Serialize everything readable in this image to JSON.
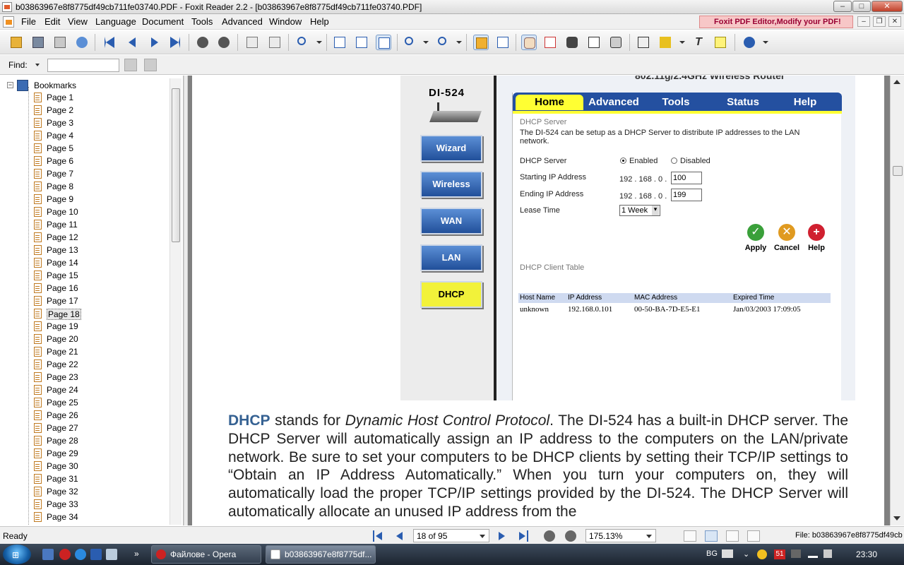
{
  "window": {
    "title": "b03863967e8f8775df49cb711fe03740.PDF - Foxit Reader 2.2 - [b03863967e8f8775df49cb711fe03740.PDF]",
    "minimize": "–",
    "maximize": "□",
    "close": "✕"
  },
  "menu": {
    "items": [
      "File",
      "Edit",
      "View",
      "Language",
      "Document",
      "Tools",
      "Advanced",
      "Window",
      "Help"
    ],
    "ad_text": "Foxit PDF Editor,Modify your PDF!"
  },
  "find": {
    "label": "Find:",
    "value": ""
  },
  "bookmarks": {
    "root_label": "Bookmarks",
    "selected_index": 17,
    "pages": [
      "Page 1",
      "Page 2",
      "Page 3",
      "Page 4",
      "Page 5",
      "Page 6",
      "Page 7",
      "Page 8",
      "Page 9",
      "Page 10",
      "Page 11",
      "Page 12",
      "Page 13",
      "Page 14",
      "Page 15",
      "Page 16",
      "Page 17",
      "Page 18",
      "Page 19",
      "Page 20",
      "Page 21",
      "Page 22",
      "Page 23",
      "Page 24",
      "Page 25",
      "Page 26",
      "Page 27",
      "Page 28",
      "Page 29",
      "Page 30",
      "Page 31",
      "Page 32",
      "Page 33",
      "Page 34"
    ]
  },
  "document": {
    "router": {
      "header_text": "802.11g/2.4GHz Wireless Router",
      "model": "DI-524",
      "nav": [
        "Wizard",
        "Wireless",
        "WAN",
        "LAN",
        "DHCP"
      ],
      "active_nav": "DHCP",
      "tabs": [
        "Home",
        "Advanced",
        "Tools",
        "Status",
        "Help"
      ],
      "active_tab": "Home",
      "section_title": "DHCP Server",
      "description": "The DI-524 can be setup as a DHCP Server to distribute IP addresses to the LAN network.",
      "dhcp_server_label": "DHCP Server",
      "enabled_label": "Enabled",
      "disabled_label": "Disabled",
      "starting_ip_label": "Starting IP Address",
      "ending_ip_label": "Ending IP Address",
      "ip_prefix": "192 . 168 . 0 .",
      "starting_ip_value": "100",
      "ending_ip_value": "199",
      "lease_time_label": "Lease Time",
      "lease_time_value": "1 Week",
      "apply": "Apply",
      "cancel": "Cancel",
      "help": "Help",
      "client_table_title": "DHCP Client Table",
      "client_table_headers": [
        "Host Name",
        "IP Address",
        "MAC Address",
        "Expired Time"
      ],
      "client_table_rows": [
        [
          "unknown",
          "192.168.0.101",
          "00-50-BA-7D-E5-E1",
          "Jan/03/2003 17:09:05"
        ]
      ]
    },
    "body_lead": "DHCP",
    "body_part1": " stands for ",
    "body_italic": "Dynamic Host Control Protocol",
    "body_part2": ". The DI-524 has a built-in DHCP server. The DHCP Server will automatically assign an IP address to the computers on the LAN/private network. Be sure to set your computers to be DHCP clients by setting their TCP/IP settings to “Obtain an IP Address Automatically.” When you turn your computers on, they will automatically load the proper TCP/IP settings provided by the DI-524. The DHCP Server will automatically allocate an unused IP address from the"
  },
  "status": {
    "ready": "Ready",
    "page_indicator": "18 of 95",
    "zoom": "175.13%",
    "file_label": "File: b03863967e8f8775df49cb"
  },
  "taskbar": {
    "start_label": "⊞",
    "tasks": [
      "Файлове - Opera",
      "b03863967e8f8775df..."
    ],
    "language": "BG",
    "badge": "51",
    "clock": "23:30"
  },
  "colors": {
    "accent_blue": "#2450a0",
    "active_yellow": "#ffff33",
    "body_lead_color": "#356192"
  }
}
